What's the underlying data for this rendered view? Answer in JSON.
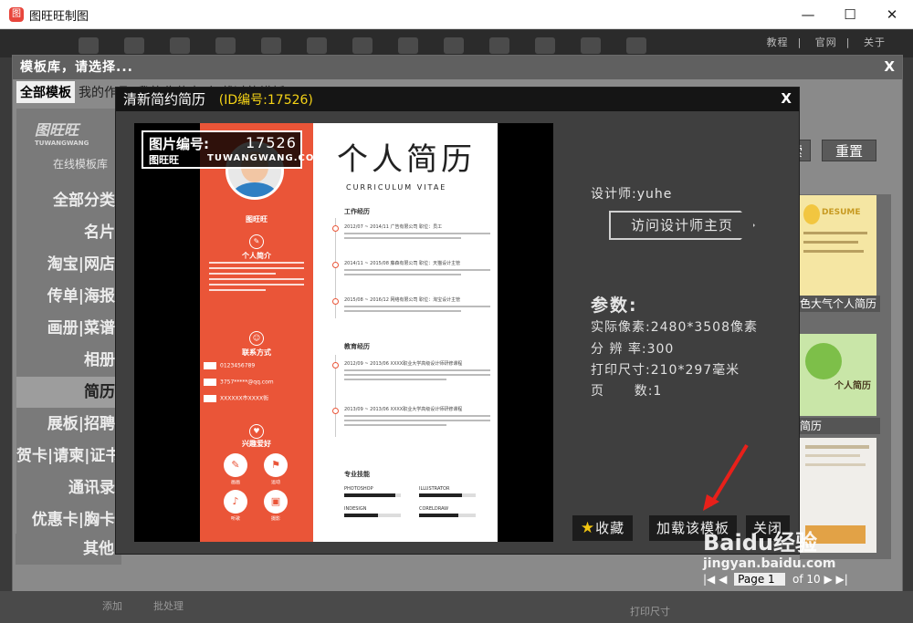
{
  "window": {
    "title": "图旺旺制图",
    "minimize": "—",
    "maximize": "☐",
    "close": "✕"
  },
  "top_links": [
    "教程",
    "官网",
    "关于"
  ],
  "library": {
    "title": "模板库，请选择...",
    "close": "X",
    "tabs": [
      "全部模板",
      "我的作品",
      "我的收藏夹",
      "加载过的模板"
    ],
    "logo": "图旺旺",
    "logo_sub_en": "TUWANGWANG",
    "logo_sub": "在线模板库",
    "categories": [
      "全部分类",
      "名片",
      "淘宝|网店",
      "传单|海报",
      "画册|菜谱",
      "相册",
      "简历",
      "展板|招聘",
      "贺卡|请柬|证书",
      "通讯录",
      "优惠卡|胸卡",
      "其他"
    ],
    "active_category": "简历",
    "search_button": "搜索",
    "reset_button": "重置",
    "thumbs": [
      {
        "label": "色大气个人简历",
        "art": "DESUME"
      },
      {
        "label": "简历",
        "art": "个人简历"
      },
      {
        "label": "",
        "art": ""
      }
    ],
    "pager": {
      "prefix": "Page",
      "current": "1",
      "total": "of 10"
    },
    "bottom": {
      "add": "添加",
      "batch": "批处理",
      "print_size": "打印尺寸"
    }
  },
  "preview": {
    "title": "清新简约简历",
    "id_label": "(ID编号:17526)",
    "close": "X",
    "watermark": {
      "label": "图片编号:",
      "number": "17526",
      "site_cn": "图旺旺",
      "site_en": "TUWANGWANG.COM"
    },
    "resume": {
      "name": "图旺旺",
      "title": "个人简历",
      "subtitle": "CURRICULUM VITAE",
      "sections": {
        "intro": "个人简介",
        "contact": "联系方式",
        "hobbies": "兴趣爱好",
        "work": "工作经历",
        "education": "教育经历",
        "skills": "专业技能"
      },
      "contacts": [
        "0123456789",
        "3757*****@qq.com",
        "XXXXXX市XXXX街"
      ],
      "hobbies": [
        "画画",
        "运动",
        "听歌",
        "摄影"
      ],
      "work": [
        {
          "date": "2012/07 ~ 2014/11",
          "company": "广告有限公司",
          "role": "职位：员工"
        },
        {
          "date": "2014/11 ~ 2015/08",
          "company": "藤森有限公司",
          "role": "职位：天猫设计主管"
        },
        {
          "date": "2015/08 ~ 2016/12",
          "company": "网络有限公司",
          "role": "职位：淘宝设计主管"
        }
      ],
      "education": [
        {
          "date": "2012/09 ~ 2013/06",
          "school": "XXXX职业大学高级设计师研修课程"
        },
        {
          "date": "2013/09 ~ 2013/06",
          "school": "XXXX职业大学高级设计师研修课程"
        }
      ],
      "skills": [
        {
          "name": "PHOTOSHOP",
          "level": 0.9
        },
        {
          "name": "ILLUSTRATOR",
          "level": 0.75
        },
        {
          "name": "INDESIGN",
          "level": 0.6
        },
        {
          "name": "CORELDRAW",
          "level": 0.7
        }
      ]
    },
    "designer": "设计师:yuhe",
    "visit_designer": "访问设计师主页",
    "params_title": "参数:",
    "params": [
      "实际像素:2480*3508像素",
      "分 辨 率:300",
      "打印尺寸:210*297毫米",
      "页      数:1"
    ],
    "buttons": {
      "favorite": "收藏",
      "load": "加载该模板",
      "close": "关闭"
    }
  },
  "watermark_site": {
    "brand": "Baidu经验",
    "url": "jingyan.baidu.com"
  }
}
